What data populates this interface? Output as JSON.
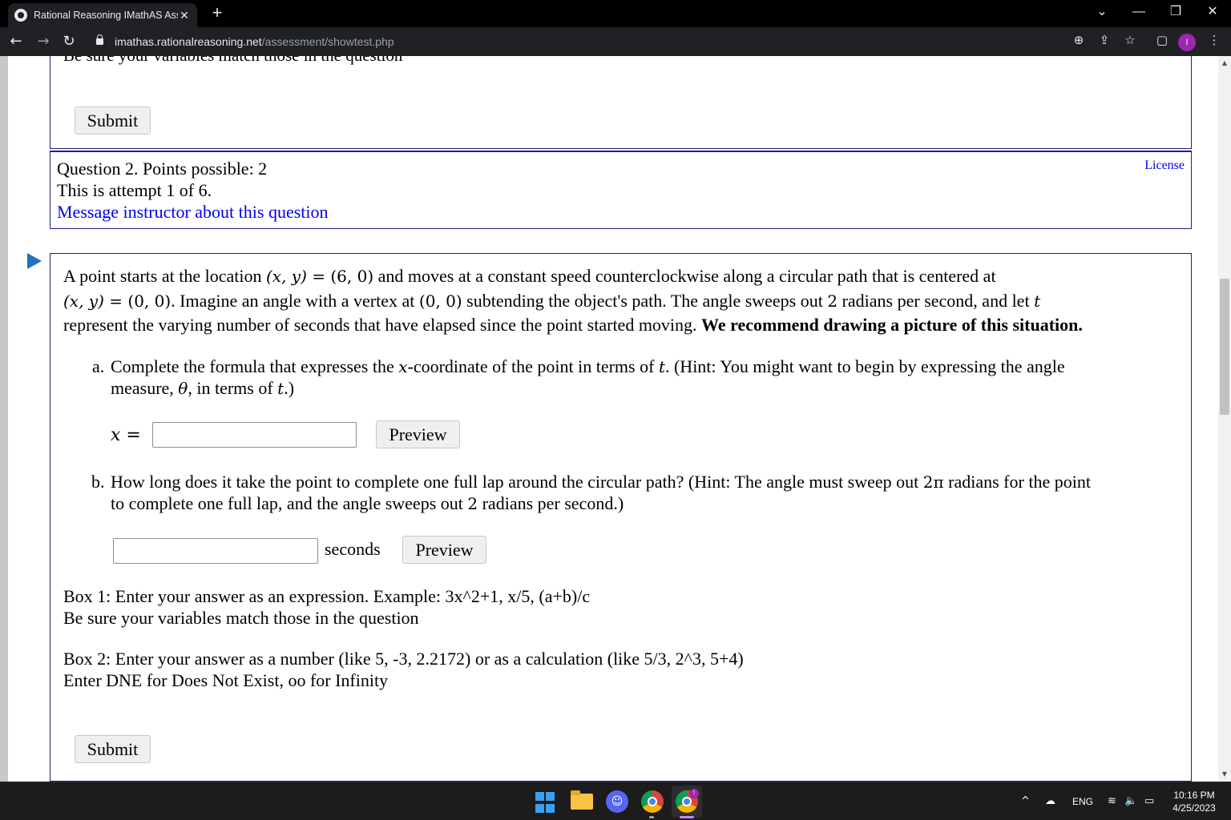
{
  "browser": {
    "tab_title": "Rational Reasoning IMathAS Asse",
    "tab_close": "✕",
    "new_tab": "+",
    "url_host": "imathas.rationalreasoning.net",
    "url_path": "/assessment/showtest.php",
    "back": "←",
    "forward": "→",
    "reload": "↻",
    "zoom_icon": "⊕",
    "share_icon": "⇪",
    "star_icon": "☆",
    "sidepanel_icon": "▢",
    "profile_initial": "I",
    "menu_icon": "⋮",
    "win_dropdown": "⌄",
    "win_min": "—",
    "win_restore": "❐",
    "win_close": "✕"
  },
  "prev_question": {
    "cut_text": "Be sure your variables match those in the question",
    "submit": "Submit"
  },
  "question_info": {
    "points_line": "Question 2. Points possible: 2",
    "attempt_line": "This is attempt 1 of 6.",
    "message_link": "Message instructor about this question",
    "license": "License"
  },
  "question": {
    "intro": {
      "l1_a": "A point starts at the location ",
      "l1_math1": "(x, y)",
      "l1_eq": " = ",
      "l1_math2": "(6, 0)",
      "l1_b": " and moves at a constant speed counterclockwise along a circular path that is centered at",
      "l2_math1": "(x, y)",
      "l2_eq": " = ",
      "l2_math2": "(0, 0)",
      "l2_a": ". Imagine an angle with a vertex at ",
      "l2_math3": "(0, 0)",
      "l2_b": " subtending the object's path. The angle sweeps out ",
      "l2_num": "2",
      "l2_c": " radians per second, and let ",
      "l2_t": "t",
      "l3_a": "represent the varying number of seconds that have elapsed since the point started moving. ",
      "l3_bold": "We recommend drawing a picture of this situation."
    },
    "part_a": {
      "marker": "a.",
      "l1_a": "Complete the formula that expresses the ",
      "l1_x": "x",
      "l1_b": "-coordinate of the point in terms of ",
      "l1_t": "t",
      "l1_c": ". (Hint: You might want to begin by expressing the angle",
      "l2_a": "measure, ",
      "l2_theta": "θ",
      "l2_b": ", in terms of ",
      "l2_t": "t",
      "l2_c": ".)",
      "lhs": "x =",
      "input_value": "",
      "preview": "Preview"
    },
    "part_b": {
      "marker": "b.",
      "l1_a": "How long does it take the point to complete one full lap around the circular path? (Hint: The angle must sweep out ",
      "l1_2pi": "2π",
      "l1_b": " radians for the point",
      "l2_a": "to complete one full lap, and the angle sweeps out ",
      "l2_num": "2",
      "l2_b": " radians per second.)",
      "input_value": "",
      "unit": "seconds",
      "preview": "Preview"
    },
    "box1_line1": "Box 1: Enter your answer as an expression. Example: 3x^2+1, x/5, (a+b)/c",
    "box1_line2": "Be sure your variables match those in the question",
    "box2_line1": "Box 2: Enter your answer as a number (like 5, -3, 2.2172) or as a calculation (like 5/3, 2^3, 5+4)",
    "box2_line2": "Enter DNE for Does Not Exist, oo for Infinity",
    "submit": "Submit"
  },
  "taskbar": {
    "discord_glyph": "☺",
    "badge": "!",
    "tray_chevron": "^",
    "cloud_icon": "☁",
    "lang": "ENG",
    "wifi_icon": "≋",
    "volume_icon": "🔈",
    "battery_icon": "▭",
    "time": "10:16 PM",
    "date": "4/25/2023"
  }
}
